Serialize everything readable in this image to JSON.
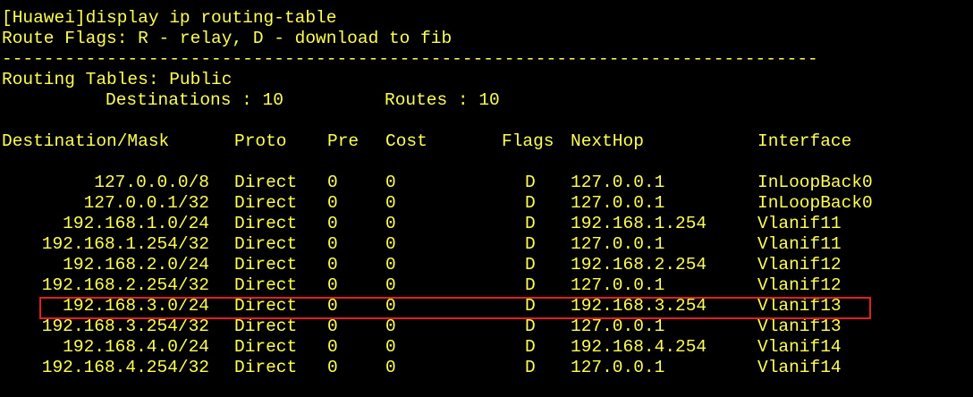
{
  "terminal": {
    "command_line": "[Huawei]display ip routing-table",
    "route_flags_line": "Route Flags: R - relay, D - download to fib",
    "separator": "------------------------------------------------------------------------------",
    "routing_tables_line": "Routing Tables: Public",
    "destinations_label": "Destinations : 10",
    "routes_label": "Routes : 10",
    "headers": {
      "destination": "Destination/Mask",
      "proto": "Proto",
      "pre": "Pre",
      "cost": "Cost",
      "flags": "Flags",
      "nexthop": "NextHop",
      "interface": "Interface"
    },
    "rows": [
      {
        "destination": "127.0.0.0/8",
        "proto": "Direct",
        "pre": "0",
        "cost": "0",
        "flags": "D",
        "nexthop": "127.0.0.1",
        "interface": "InLoopBack0"
      },
      {
        "destination": "127.0.0.1/32",
        "proto": "Direct",
        "pre": "0",
        "cost": "0",
        "flags": "D",
        "nexthop": "127.0.0.1",
        "interface": "InLoopBack0"
      },
      {
        "destination": "192.168.1.0/24",
        "proto": "Direct",
        "pre": "0",
        "cost": "0",
        "flags": "D",
        "nexthop": "192.168.1.254",
        "interface": "Vlanif11"
      },
      {
        "destination": "192.168.1.254/32",
        "proto": "Direct",
        "pre": "0",
        "cost": "0",
        "flags": "D",
        "nexthop": "127.0.0.1",
        "interface": "Vlanif11"
      },
      {
        "destination": "192.168.2.0/24",
        "proto": "Direct",
        "pre": "0",
        "cost": "0",
        "flags": "D",
        "nexthop": "192.168.2.254",
        "interface": "Vlanif12"
      },
      {
        "destination": "192.168.2.254/32",
        "proto": "Direct",
        "pre": "0",
        "cost": "0",
        "flags": "D",
        "nexthop": "127.0.0.1",
        "interface": "Vlanif12"
      },
      {
        "destination": "192.168.3.0/24",
        "proto": "Direct",
        "pre": "0",
        "cost": "0",
        "flags": "D",
        "nexthop": "192.168.3.254",
        "interface": "Vlanif13"
      },
      {
        "destination": "192.168.3.254/32",
        "proto": "Direct",
        "pre": "0",
        "cost": "0",
        "flags": "D",
        "nexthop": "127.0.0.1",
        "interface": "Vlanif13"
      },
      {
        "destination": "192.168.4.0/24",
        "proto": "Direct",
        "pre": "0",
        "cost": "0",
        "flags": "D",
        "nexthop": "192.168.4.254",
        "interface": "Vlanif14"
      },
      {
        "destination": "192.168.4.254/32",
        "proto": "Direct",
        "pre": "0",
        "cost": "0",
        "flags": "D",
        "nexthop": "127.0.0.1",
        "interface": "Vlanif14"
      }
    ],
    "highlighted_row_index": 6,
    "colors": {
      "background": "#000000",
      "text": "#ffff55",
      "highlight_border": "#e02020"
    }
  }
}
